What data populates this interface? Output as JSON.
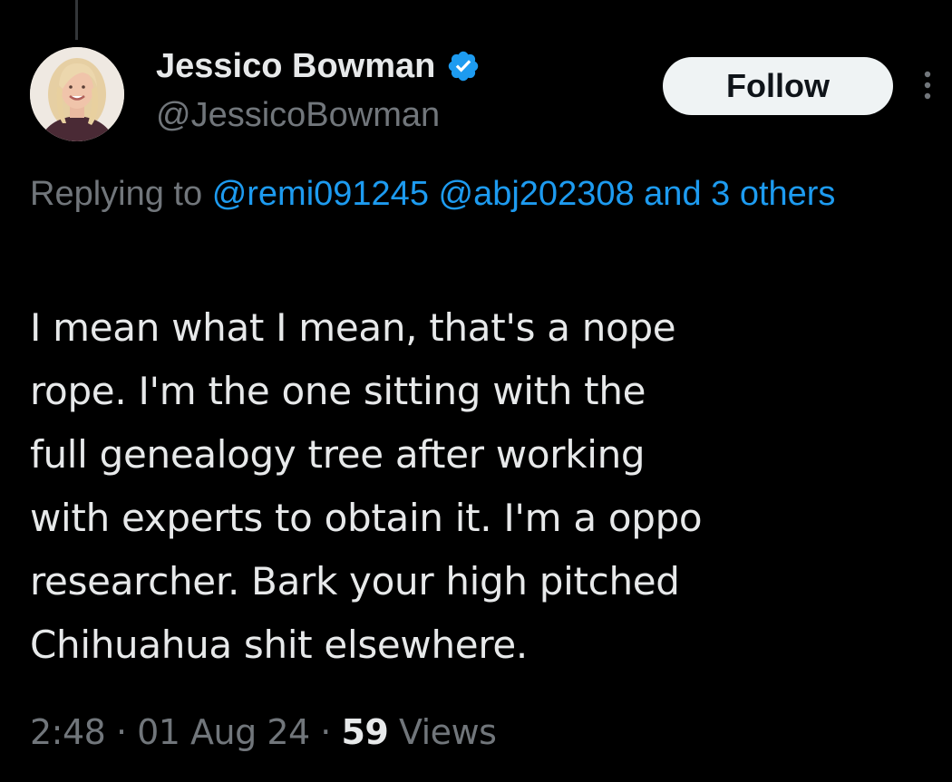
{
  "author": {
    "display_name": "Jessico Bowman",
    "handle": "@JessicoBowman",
    "verified": true,
    "avatar_icon": "profile-photo"
  },
  "actions": {
    "follow_label": "Follow",
    "more_icon": "more-vertical-icon"
  },
  "reply": {
    "prefix": "Replying to",
    "mentions": [
      "@remi091245",
      "@abj202308"
    ],
    "others": "and 3 others"
  },
  "tweet": {
    "lines": [
      "I mean what I mean, that's a nope",
      "rope. I'm the one sitting with the",
      "full genealogy tree after working",
      "with experts to obtain it. I'm a oppo",
      "researcher. Bark your high pitched",
      "Chihuahua shit elsewhere."
    ]
  },
  "meta": {
    "time": "2:48",
    "separator": "·",
    "date": "01 Aug 24",
    "views_count": "59",
    "views_label": "Views"
  },
  "colors": {
    "background": "#000000",
    "text_primary": "#e7e9ea",
    "text_secondary": "#71767b",
    "accent": "#1d9bf0",
    "follow_bg": "#eff3f4"
  }
}
